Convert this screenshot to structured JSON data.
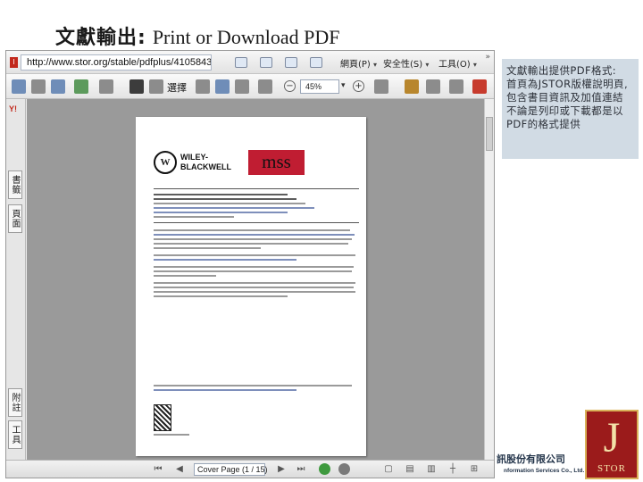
{
  "slide": {
    "title_cjk": "文獻輸出:",
    "title_latin": "Print or Download PDF"
  },
  "browser": {
    "url": "http://www.stor.org/stable/pdfplus/41058430",
    "tab_icon": "I",
    "menus": [
      {
        "label": "網頁(P)"
      },
      {
        "label": "安全性(S)"
      },
      {
        "label": "工具(O)"
      }
    ],
    "double_arrow": "»"
  },
  "pdf_toolbar": {
    "select_label": "選擇",
    "zoom_value": "45%",
    "icons": [
      "save-icon",
      "print-icon",
      "email-icon",
      "search-icon",
      "hand-icon",
      "select-icon",
      "zoom-icon",
      "zoom-out-icon",
      "zoom-in-icon",
      "fit-page-icon",
      "comment-icon",
      "sign-icon"
    ]
  },
  "left_panel": {
    "logo": "Y!",
    "tabs": [
      "書籤",
      "頁面",
      "附註",
      "工具"
    ]
  },
  "pdf_page": {
    "brand_wiley": "WILEY-BLACKWELL",
    "brand_mss": "mss"
  },
  "statusbar": {
    "page_label": "Cover Page  (1 / 15)"
  },
  "note": {
    "line1": "文獻輸出提供PDF格式:",
    "line2": "首頁為JSTOR版權說明頁, 包含書目資訊及加值連結",
    "line3": "不論是列印或下載都是以 PDF的格式提供"
  },
  "footer": {
    "company_cn": "訊股份有限公司",
    "company_en": "nformation Services Co., Ltd.",
    "logo_letter": "J",
    "logo_text": "STOR"
  },
  "colors": {
    "note_bg": "#d1dbe4",
    "mss_red": "#c01d32",
    "jstor_red": "#9b1b1b",
    "jstor_gold": "#d9b25a"
  }
}
